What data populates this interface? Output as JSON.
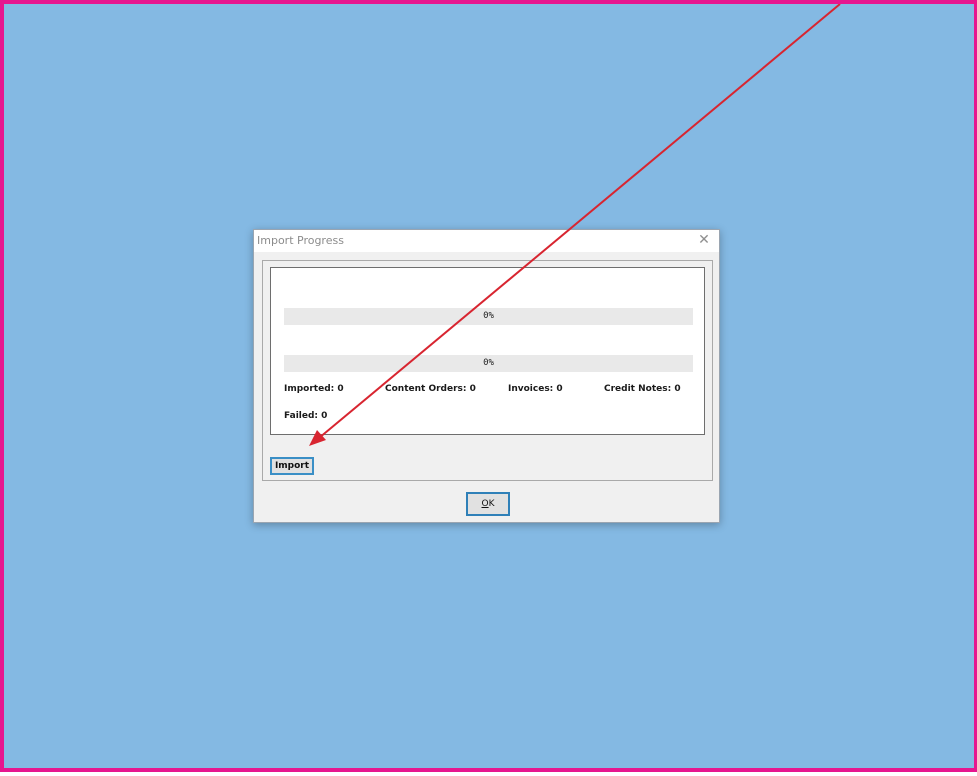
{
  "dialog": {
    "title": "Import Progress",
    "close_glyph": "✕"
  },
  "progress": [
    {
      "label": "0%",
      "value": 0
    },
    {
      "label": "0%",
      "value": 0
    }
  ],
  "stats": {
    "imported": "Imported: 0",
    "content_orders": "Content Orders: 0",
    "invoices": "Invoices: 0",
    "credit_notes": "Credit Notes: 0",
    "failed": "Failed: 0"
  },
  "buttons": {
    "import_label": "Import",
    "ok_label": "OK",
    "ok_mnemonic": "O"
  },
  "colors": {
    "desktop_background": "#84b9e3",
    "border_highlight": "#e6168f",
    "annotation_arrow": "#d82530",
    "progress_track": "#e9e9e9",
    "progress_fill": "#06b025"
  },
  "icons": {
    "close": "close-icon",
    "annotation": "arrow-annotation-icon"
  }
}
